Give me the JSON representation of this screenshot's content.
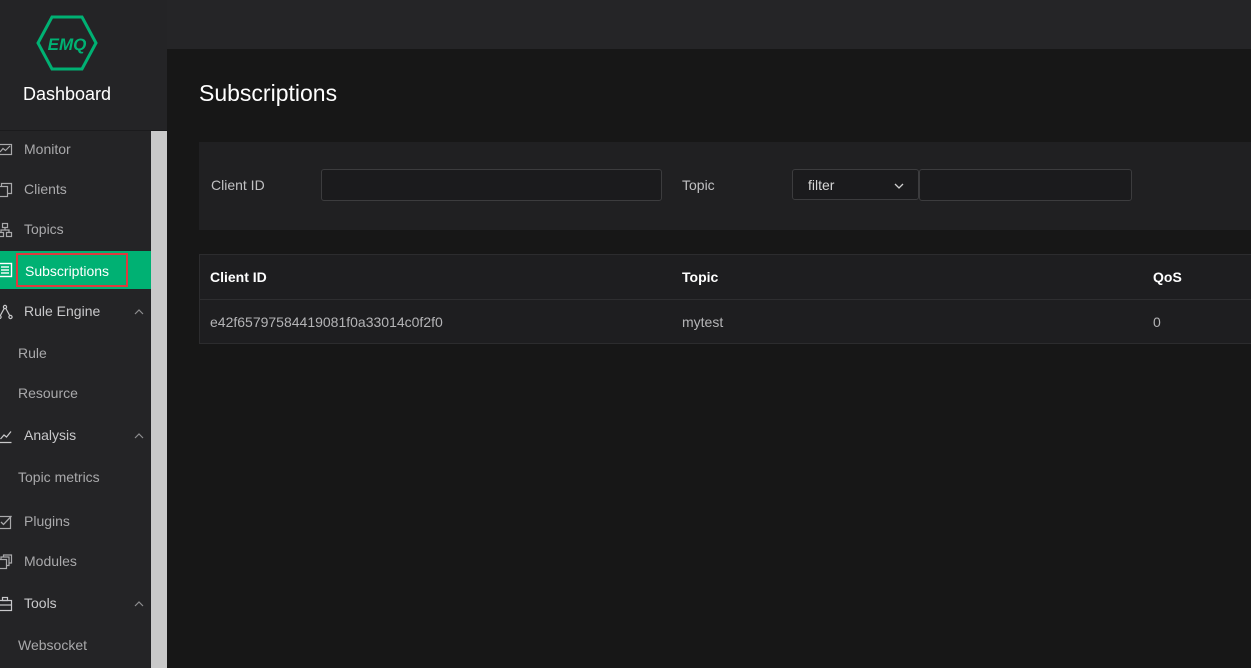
{
  "brand": {
    "logo_text": "EMQ",
    "title": "Dashboard",
    "accent": "#00b173"
  },
  "sidebar": {
    "items": [
      {
        "label": "Monitor",
        "icon": "monitor-icon"
      },
      {
        "label": "Clients",
        "icon": "clients-icon"
      },
      {
        "label": "Topics",
        "icon": "topics-icon"
      },
      {
        "label": "Subscriptions",
        "icon": "subscriptions-icon",
        "active": true
      },
      {
        "label": "Rule Engine",
        "icon": "rule-engine-icon",
        "expanded": true
      },
      {
        "label": "Rule",
        "sub": true
      },
      {
        "label": "Resource",
        "sub": true
      },
      {
        "label": "Analysis",
        "icon": "analysis-icon",
        "expanded": true
      },
      {
        "label": "Topic metrics",
        "sub": true
      },
      {
        "label": "Plugins",
        "icon": "plugins-icon"
      },
      {
        "label": "Modules",
        "icon": "modules-icon"
      },
      {
        "label": "Tools",
        "icon": "tools-icon",
        "expanded": true
      },
      {
        "label": "Websocket",
        "sub": true
      }
    ]
  },
  "page": {
    "title": "Subscriptions"
  },
  "filters": {
    "client_id_label": "Client ID",
    "client_id_value": "",
    "topic_label": "Topic",
    "topic_match_selected": "filter",
    "topic_value": ""
  },
  "table": {
    "columns": [
      "Client ID",
      "Topic",
      "QoS"
    ],
    "rows": [
      [
        "e42f65797584419081f0a33014c0f2f0",
        "mytest",
        "0"
      ]
    ]
  },
  "colors": {
    "active_highlight_border": "#e0383e",
    "sidebar_bg": "#242426",
    "content_bg": "#171717"
  }
}
